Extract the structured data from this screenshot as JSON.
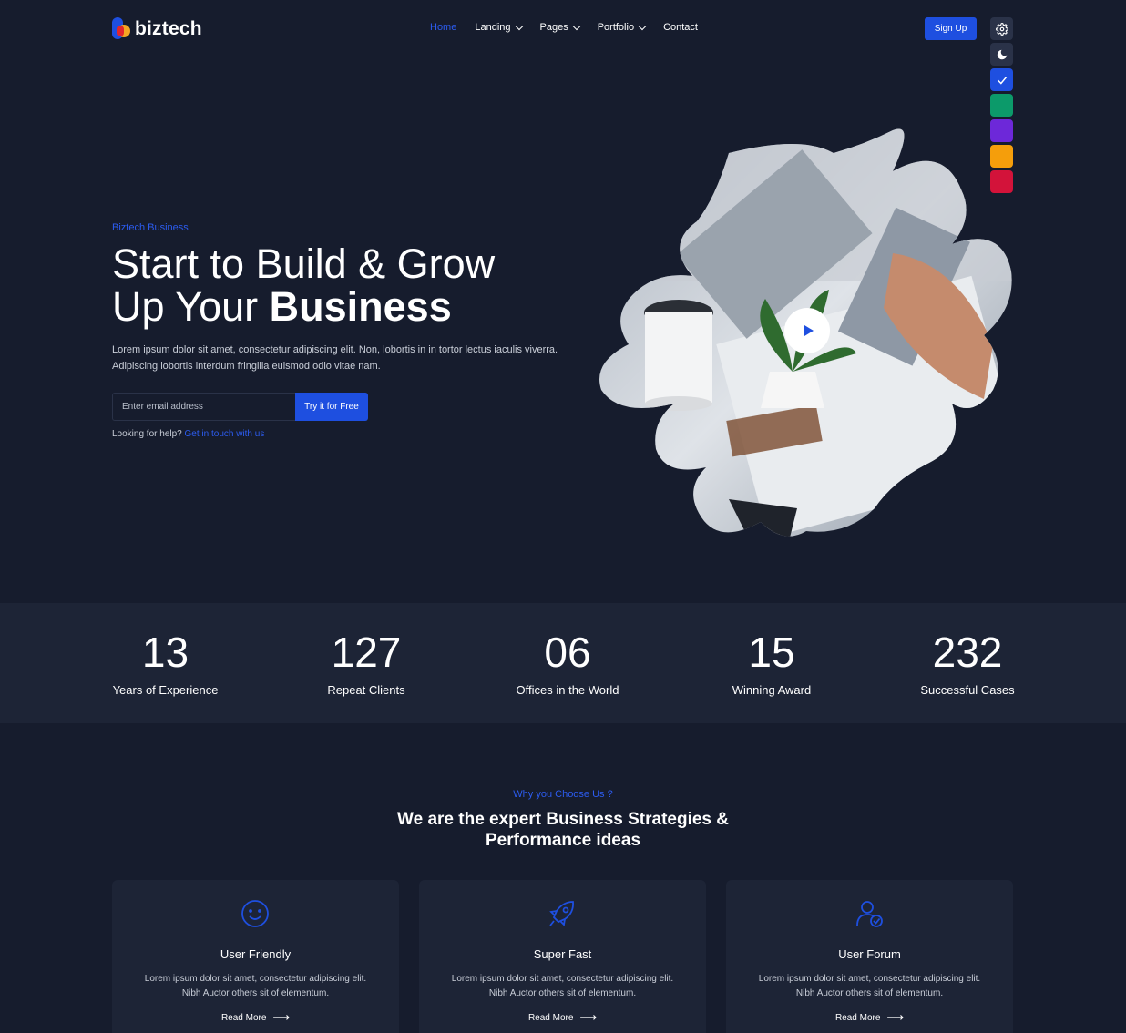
{
  "header": {
    "logo_text": "biztech",
    "nav": [
      {
        "label": "Home",
        "active": true,
        "dropdown": false
      },
      {
        "label": "Landing",
        "active": false,
        "dropdown": true
      },
      {
        "label": "Pages",
        "active": false,
        "dropdown": true
      },
      {
        "label": "Portfolio",
        "active": false,
        "dropdown": true
      },
      {
        "label": "Contact",
        "active": false,
        "dropdown": false
      }
    ],
    "signup_label": "Sign Up"
  },
  "theme_switcher": {
    "items": [
      "gear-icon",
      "moon-icon",
      "check-icon",
      "green",
      "purple",
      "orange",
      "red"
    ],
    "colors": [
      "#2a3248",
      "#2a3248",
      "#1e4fe0",
      "#0c9a6a",
      "#6d28d9",
      "#f59e0b",
      "#d3133a"
    ],
    "selected": "#1e4fe0"
  },
  "hero": {
    "eyebrow": "Biztech Business",
    "title_line1": "Start to Build & Grow",
    "title_line2_regular": "Up Your ",
    "title_line2_bold": "Business",
    "description": "Lorem ipsum dolor sit amet, consectetur adipiscing elit. Non, lobortis in in tortor lectus iaculis viverra. Adipiscing lobortis interdum fringilla euismod odio vitae nam.",
    "email_placeholder": "Enter email address",
    "cta_label": "Try it for Free",
    "help_text": "Looking for help?",
    "help_link": "Get in touch with us"
  },
  "stats": [
    {
      "value": "13",
      "label": "Years of  Experience"
    },
    {
      "value": "127",
      "label": "Repeat Clients"
    },
    {
      "value": "06",
      "label": "Offices in the World"
    },
    {
      "value": "15",
      "label": "Winning Award"
    },
    {
      "value": "232",
      "label": "Successful Cases"
    }
  ],
  "why": {
    "eyebrow": "Why you Choose Us ?",
    "title_regular": "We are the expert ",
    "title_bold": "Business Strategies & Performance ideas"
  },
  "features": [
    {
      "icon": "smile-icon",
      "title": "User Friendly",
      "description": "Lorem ipsum dolor sit amet, consectetur adipiscing elit. Nibh Auctor others sit of elementum.",
      "link": "Read More"
    },
    {
      "icon": "rocket-icon",
      "title": "Super Fast",
      "description": "Lorem ipsum dolor sit amet, consectetur adipiscing elit. Nibh Auctor others sit of elementum.",
      "link": "Read More"
    },
    {
      "icon": "user-check-icon",
      "title": "User Forum",
      "description": "Lorem ipsum dolor sit amet, consectetur adipiscing elit. Nibh Auctor others sit of elementum.",
      "link": "Read More"
    }
  ],
  "colors": {
    "background": "#161c2d",
    "panel": "#1d2436",
    "accent": "#1e4fe0"
  }
}
